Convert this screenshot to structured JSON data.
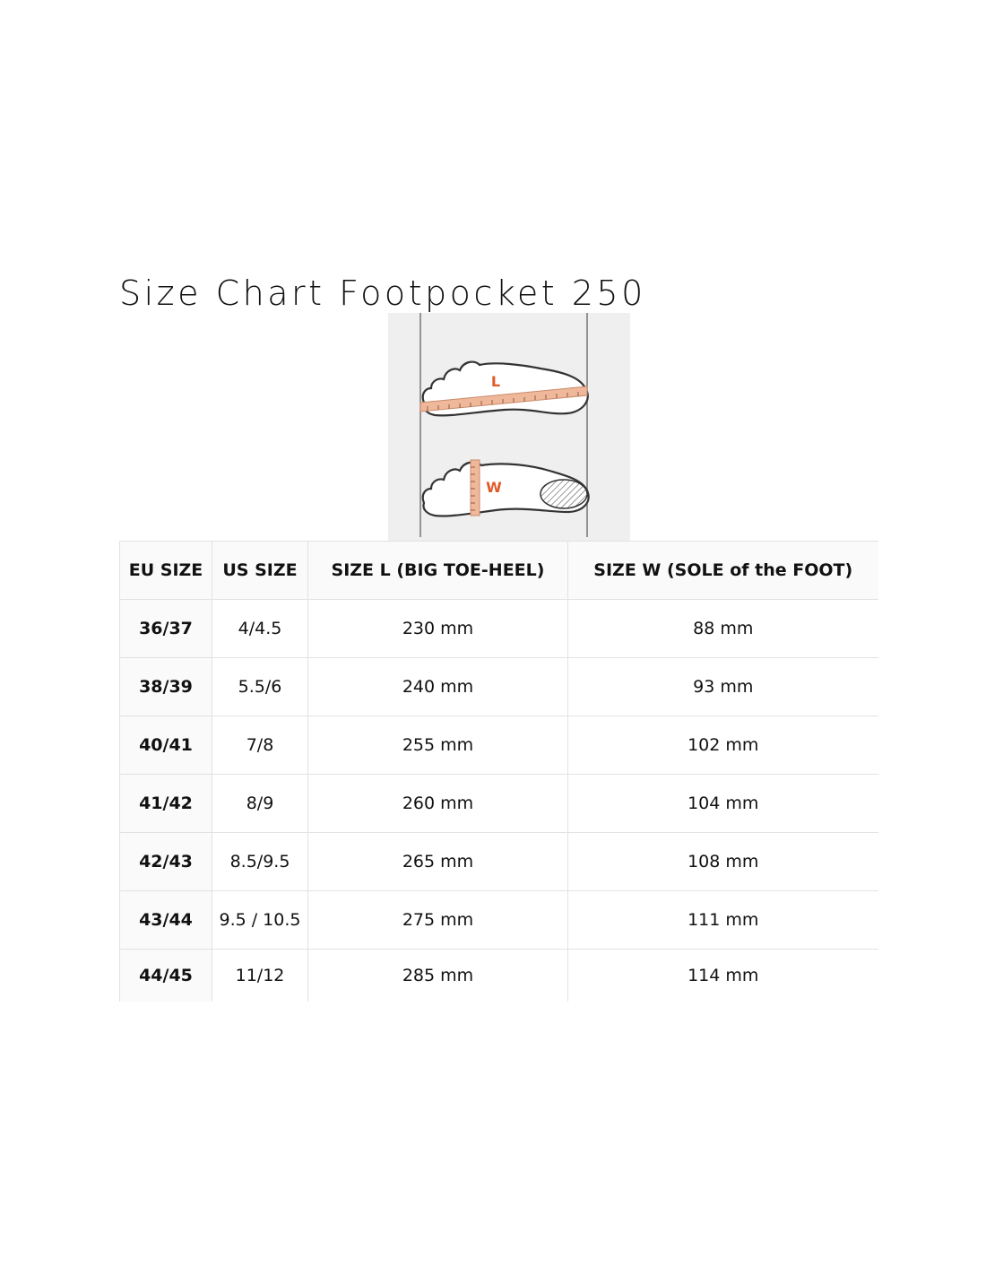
{
  "title": "Size Chart Footpocket 250",
  "diagram": {
    "label_length": "L",
    "label_width": "W",
    "accent_color": "#e05a2a",
    "ruler_color": "#f0b89a"
  },
  "table": {
    "headers": [
      "EU SIZE",
      "US SIZE",
      "SIZE L (BIG TOE-HEEL)",
      "SIZE W (SOLE of the FOOT)"
    ],
    "rows": [
      [
        "36/37",
        "4/4.5",
        "230 mm",
        "88 mm"
      ],
      [
        "38/39",
        "5.5/6",
        "240 mm",
        "93 mm"
      ],
      [
        "40/41",
        "7/8",
        "255 mm",
        "102 mm"
      ],
      [
        "41/42",
        "8/9",
        "260 mm",
        "104 mm"
      ],
      [
        "42/43",
        "8.5/9.5",
        "265 mm",
        "108 mm"
      ],
      [
        "43/44",
        "9.5 / 10.5",
        "275 mm",
        "111 mm"
      ],
      [
        "44/45",
        "11/12",
        "285 mm",
        "114 mm"
      ]
    ]
  }
}
